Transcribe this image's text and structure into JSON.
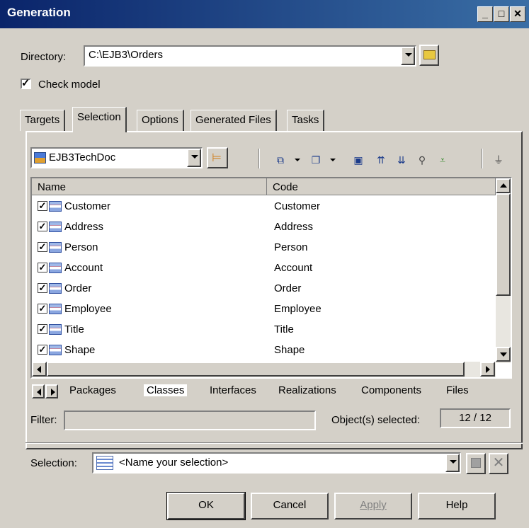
{
  "window": {
    "title": "Generation"
  },
  "directory": {
    "label": "Directory:",
    "value": "C:\\EJB3\\Orders"
  },
  "check_model": {
    "label": "Check model",
    "checked": true
  },
  "tabs": [
    "Targets",
    "Selection",
    "Options",
    "Generated Files",
    "Tasks"
  ],
  "active_tab": "Selection",
  "model_combo": {
    "value": "EJB3TechDoc"
  },
  "grid": {
    "columns": [
      "Name",
      "Code"
    ],
    "rows": [
      {
        "name": "Customer",
        "code": "Customer"
      },
      {
        "name": "Address",
        "code": "Address"
      },
      {
        "name": "Person",
        "code": "Person"
      },
      {
        "name": "Account",
        "code": "Account"
      },
      {
        "name": "Order",
        "code": "Order"
      },
      {
        "name": "Employee",
        "code": "Employee"
      },
      {
        "name": "Title",
        "code": "Title"
      },
      {
        "name": "Shape",
        "code": "Shape"
      }
    ]
  },
  "bottom_tabs": [
    "Packages",
    "Classes",
    "Interfaces",
    "Realizations",
    "Components",
    "Files"
  ],
  "filter": {
    "label": "Filter:",
    "value": ""
  },
  "objects_selected": {
    "label": "Object(s) selected:",
    "value": "12 / 12"
  },
  "selection": {
    "label": "Selection:",
    "placeholder": "<Name your selection>"
  },
  "buttons": {
    "ok": "OK",
    "cancel": "Cancel",
    "apply": "Apply",
    "help": "Help"
  }
}
